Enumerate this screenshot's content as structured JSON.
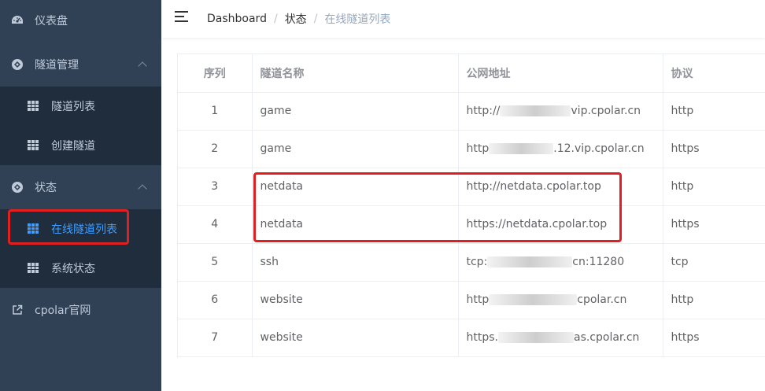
{
  "sidebar": {
    "items": [
      {
        "label": "仪表盘",
        "icon": "dashboard-icon"
      },
      {
        "label": "隧道管理",
        "icon": "cpolar-icon",
        "expanded": true,
        "children": [
          {
            "label": "隧道列表",
            "icon": "table-icon"
          },
          {
            "label": "创建隧道",
            "icon": "table-icon"
          }
        ]
      },
      {
        "label": "状态",
        "icon": "cpolar-icon",
        "expanded": true,
        "children": [
          {
            "label": "在线隧道列表",
            "icon": "table-icon",
            "active": true
          },
          {
            "label": "系统状态",
            "icon": "table-icon"
          }
        ]
      },
      {
        "label": "cpolar官网",
        "icon": "external-link-icon"
      }
    ]
  },
  "header": {
    "breadcrumb": [
      "Dashboard",
      "状态",
      "在线隧道列表"
    ]
  },
  "table": {
    "columns": [
      "序列",
      "隧道名称",
      "公网地址",
      "协议"
    ],
    "rows": [
      {
        "idx": "1",
        "name": "game",
        "addr_pre": "http://",
        "addr_post": "vip.cpolar.cn",
        "protocol": "http"
      },
      {
        "idx": "2",
        "name": "game",
        "addr_pre": "http",
        "addr_post": ".12.vip.cpolar.cn",
        "protocol": "https"
      },
      {
        "idx": "3",
        "name": "netdata",
        "addr_pre": "http://netdata.cpolar.top",
        "addr_post": "",
        "protocol": "http"
      },
      {
        "idx": "4",
        "name": "netdata",
        "addr_pre": "https://netdata.cpolar.top",
        "addr_post": "",
        "protocol": "https"
      },
      {
        "idx": "5",
        "name": "ssh",
        "addr_pre": "tcp:",
        "addr_post": "cn:11280",
        "protocol": "tcp"
      },
      {
        "idx": "6",
        "name": "website",
        "addr_pre": "http",
        "addr_post": "cpolar.cn",
        "protocol": "http"
      },
      {
        "idx": "7",
        "name": "website",
        "addr_pre": "https.",
        "addr_post": "as.cpolar.cn",
        "protocol": "https"
      }
    ]
  },
  "colors": {
    "sidebar_bg": "#304156",
    "submenu_bg": "#1f2d3d",
    "active": "#409eff",
    "highlight": "#e02020"
  }
}
